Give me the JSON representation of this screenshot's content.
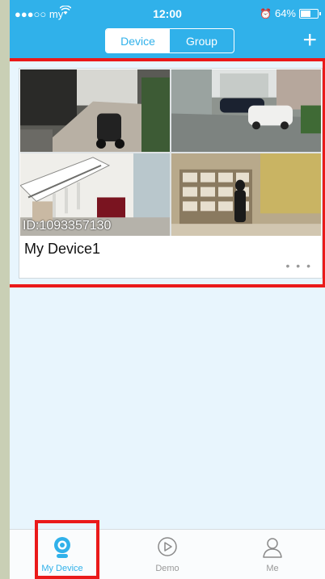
{
  "status_bar": {
    "carrier": "●●●○○ my",
    "time": "12:00",
    "battery": "64%",
    "battery_level": 0.64
  },
  "header": {
    "segments": [
      {
        "label": "Device",
        "active": true
      },
      {
        "label": "Group",
        "active": false
      }
    ],
    "add_icon": "plus-icon"
  },
  "device_card": {
    "device_id": "ID:1093357130",
    "device_name": "My Device1",
    "more_label": "• • •",
    "camera_views": [
      "camera-view-1",
      "camera-view-2",
      "camera-view-3",
      "camera-view-4"
    ]
  },
  "tab_bar": {
    "tabs": [
      {
        "label": "My Device",
        "icon": "camera-icon",
        "active": true
      },
      {
        "label": "Demo",
        "icon": "play-icon",
        "active": false
      },
      {
        "label": "Me",
        "icon": "person-icon",
        "active": false
      }
    ]
  },
  "colors": {
    "accent": "#30b1ea",
    "highlight": "#ea1a1a",
    "background": "#e8f5fd"
  }
}
